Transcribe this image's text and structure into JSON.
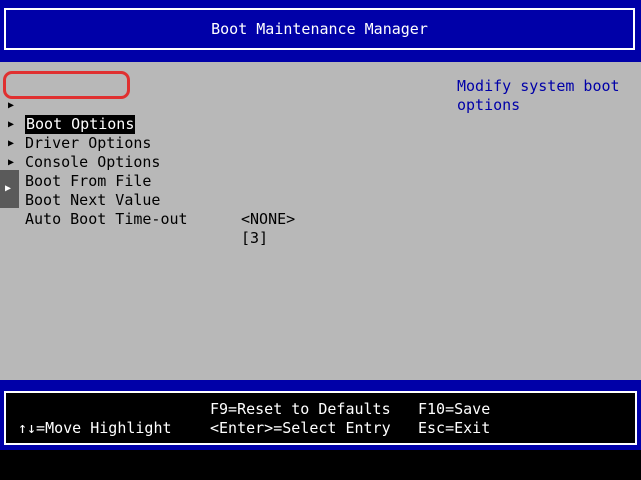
{
  "header": {
    "title": "Boot Maintenance Manager"
  },
  "menu": {
    "items": [
      {
        "label": "Boot Options"
      },
      {
        "label": "Driver Options"
      },
      {
        "label": "Console Options"
      },
      {
        "label": "Boot From File"
      }
    ],
    "settings": [
      {
        "label": "Boot Next Value",
        "value": "<NONE>"
      },
      {
        "label": "Auto Boot Time-out",
        "value": "[3]"
      }
    ]
  },
  "help": {
    "text": "Modify system boot options"
  },
  "footer": {
    "reset": "F9=Reset to Defaults",
    "save": "F10=Save",
    "move": "↑↓=Move Highlight",
    "select": "<Enter>=Select Entry",
    "exit": "Esc=Exit"
  },
  "colors": {
    "background": "#b8b8b8",
    "header": "#0000a8",
    "help_text": "#0000a8",
    "selection": "#000000",
    "highlight_ring": "#e03030"
  },
  "icons": {
    "menu_arrow": "triangle-right-icon"
  }
}
